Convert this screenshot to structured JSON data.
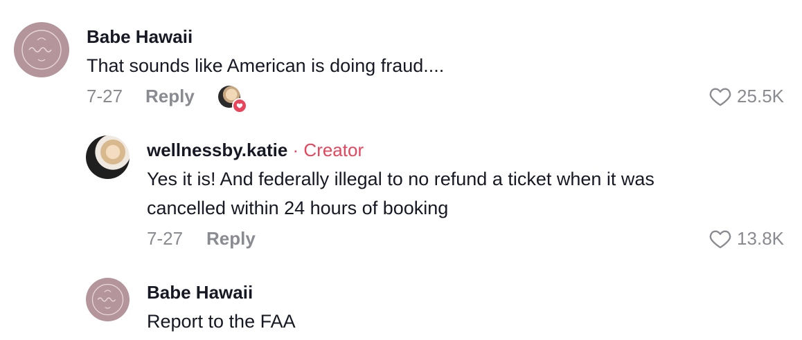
{
  "comments": [
    {
      "author": "Babe Hawaii",
      "text": "That sounds like American is doing fraud....",
      "date": "7-27",
      "reply_label": "Reply",
      "likes": "25.5K",
      "avatar_icon": "logo-circle-icon",
      "liked_by_creator": true
    },
    {
      "author": "wellnessby.katie",
      "badge": "· Creator",
      "text_line1": "Yes it is! And federally illegal to no refund a ticket when it was",
      "text_line2": "cancelled within 24 hours of booking",
      "date": "7-27",
      "reply_label": "Reply",
      "likes": "13.8K",
      "avatar_icon": "photo-avatar"
    },
    {
      "author": "Babe Hawaii",
      "text": "Report to the FAA",
      "avatar_icon": "logo-circle-icon"
    }
  ],
  "colors": {
    "creator_accent": "#e8455c",
    "meta_gray": "#8a8b91",
    "avatar_mauve": "#b4959c"
  }
}
